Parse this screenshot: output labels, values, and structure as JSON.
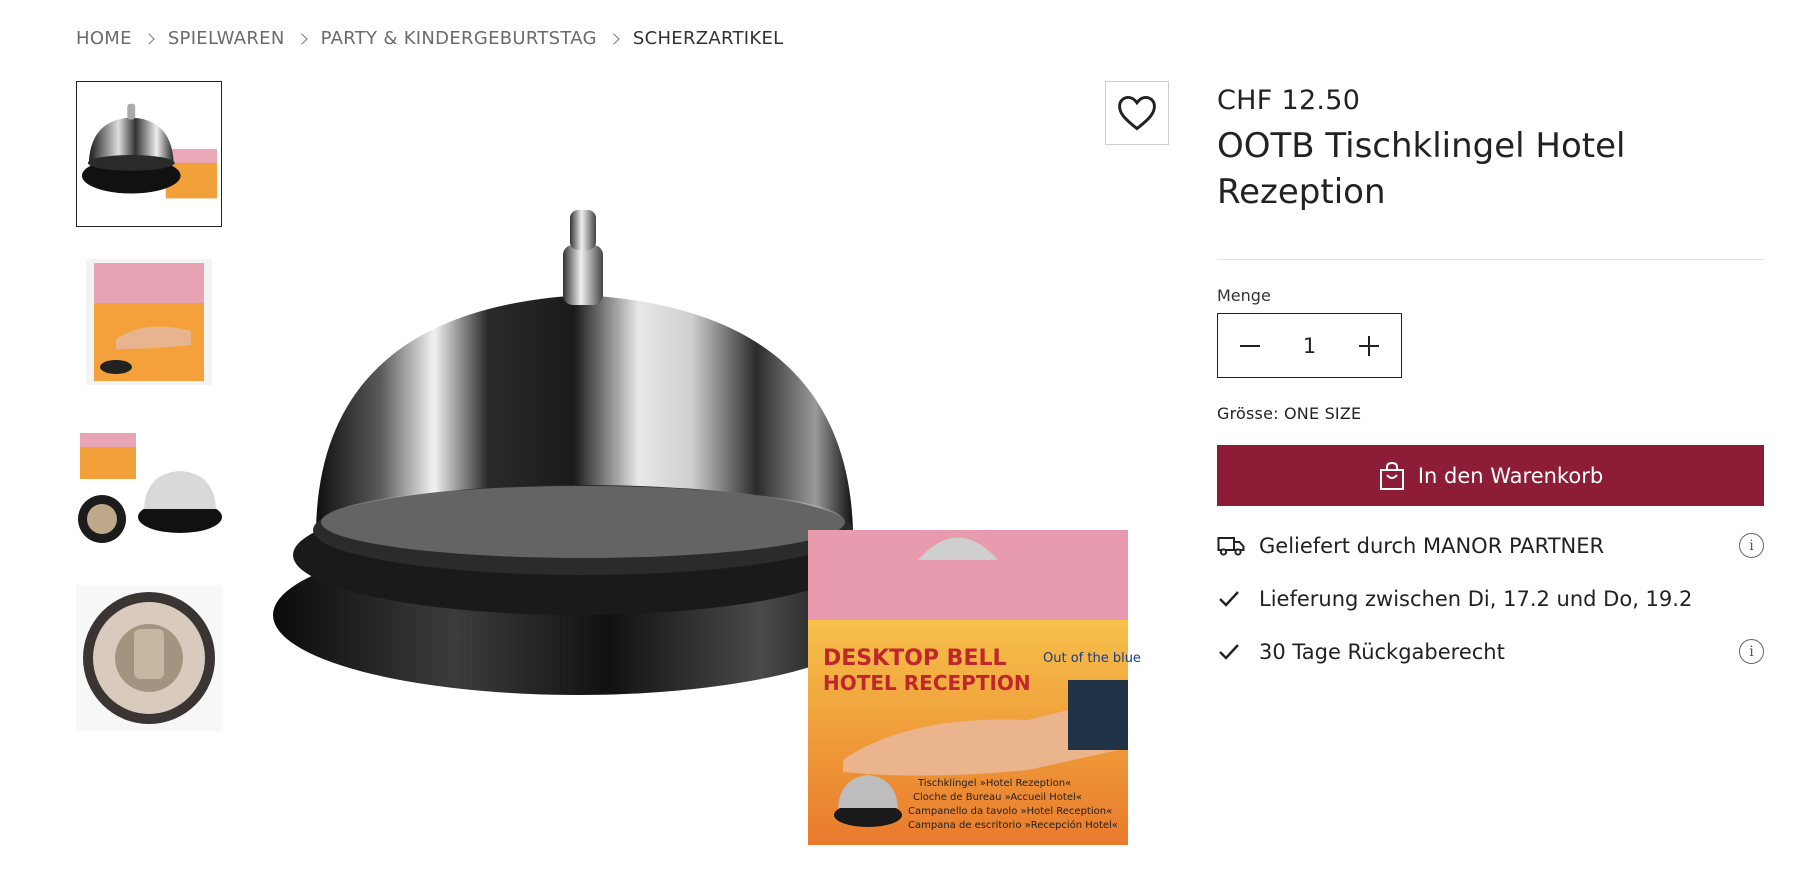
{
  "breadcrumb": {
    "items": [
      "HOME",
      "SPIELWAREN",
      "PARTY & KINDERGEBURTSTAG",
      "SCHERZARTIKEL"
    ]
  },
  "gallery": {
    "thumbnail_count": 4,
    "active_index": 0,
    "box_print": {
      "title_line1": "DESKTOP BELL",
      "title_line2": "HOTEL RECEPTION",
      "brand": "Out of the blue",
      "caption_lines": [
        "Tischklingel »Hotel Rezeption«",
        "Cloche de Bureau »Accueil Hotel«",
        "Campanello da tavolo »Hotel Reception«",
        "Campana de escritorio »Recepción Hotel«"
      ]
    }
  },
  "wishlist": {
    "icon": "heart-icon"
  },
  "product": {
    "price": "CHF 12.50",
    "title": "OOTB Tischklingel Hotel Rezeption",
    "quantity_label": "Menge",
    "quantity": "1",
    "size_text": "Grösse: ONE SIZE",
    "cart_label": "In den Warenkorb",
    "cart_color": "#8d1d36"
  },
  "delivery": {
    "items": [
      {
        "icon": "truck-icon",
        "text": "Geliefert durch MANOR PARTNER",
        "has_info": true
      },
      {
        "icon": "check-icon",
        "text": "Lieferung zwischen Di, 17.2 und Do, 19.2",
        "has_info": false
      },
      {
        "icon": "check-icon",
        "text": "30 Tage Rückgaberecht",
        "has_info": true
      }
    ],
    "info_glyph": "i"
  }
}
